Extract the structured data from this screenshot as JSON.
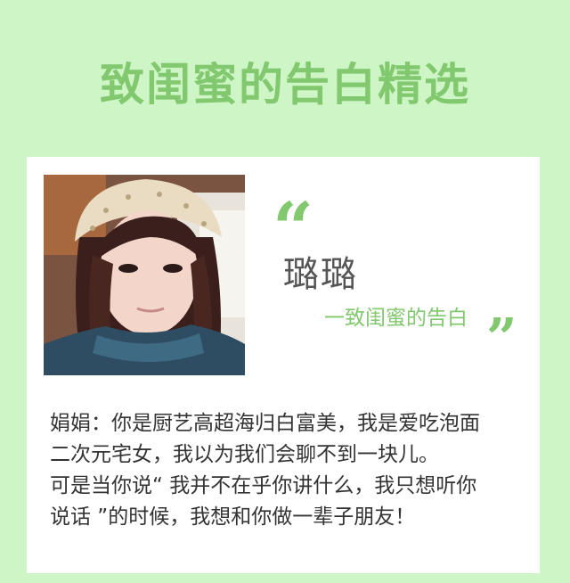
{
  "page": {
    "title": "致闺蜜的告白精选"
  },
  "card": {
    "quote_open": "“",
    "quote_close": "”",
    "name": "璐璐",
    "subtitle": "一致闺蜜的告白",
    "body_lines": [
      "娟娟：你是厨艺高超海归白富美，我是爱吃泡面",
      "二次元宅女，我以为我们会聊不到一块儿。",
      "可是当你说“ 我并不在乎你讲什么，我只想听你",
      "说话 ”的时候，我想和你做一辈子朋友！"
    ]
  },
  "colors": {
    "background": "#cdf5c5",
    "accent": "#82c86f",
    "card": "#ffffff",
    "name_text": "#555555",
    "body_text": "#333333"
  }
}
